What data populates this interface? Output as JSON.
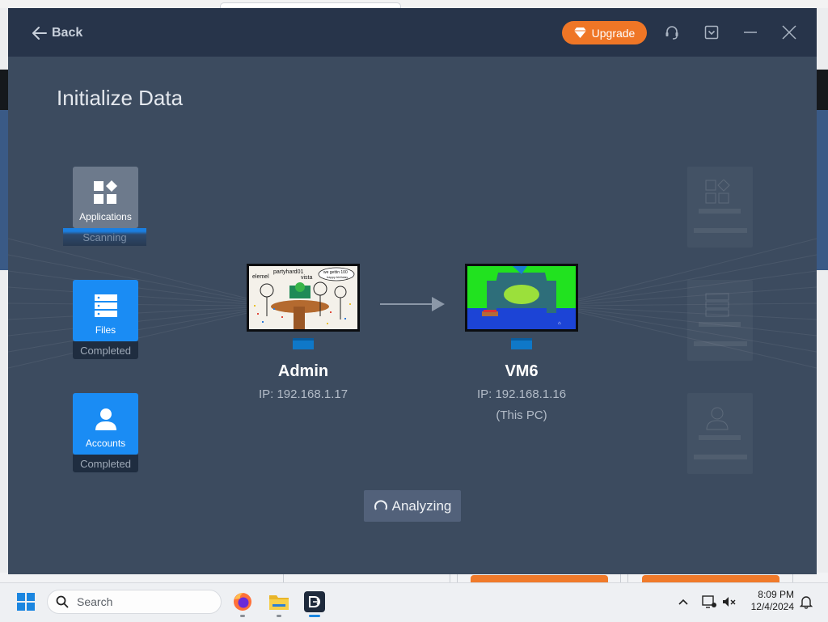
{
  "window": {
    "back_label": "Back",
    "upgrade_label": "Upgrade",
    "page_title": "Initialize Data"
  },
  "categories": [
    {
      "label": "Applications",
      "status": "Scanning",
      "icon": "apps-icon"
    },
    {
      "label": "Files",
      "status": "Completed",
      "icon": "files-icon"
    },
    {
      "label": "Accounts",
      "status": "Completed",
      "icon": "user-icon"
    }
  ],
  "source_pc": {
    "name": "Admin",
    "ip": "IP: 192.168.1.17"
  },
  "target_pc": {
    "name": "VM6",
    "ip": "IP: 192.168.1.16",
    "note": "(This PC)"
  },
  "source_screen_text": [
    "partyhard01",
    "vista",
    "elemel",
    "we gettin 100",
    "happy birthday"
  ],
  "analyzing_label": "Analyzing",
  "taskbar": {
    "search_placeholder": "Search",
    "time": "8:09 PM",
    "date": "12/4/2024"
  },
  "colors": {
    "accent_orange": "#ef7626",
    "tile_blue": "#1a8cf4",
    "window_bg": "#3c4b5f"
  }
}
